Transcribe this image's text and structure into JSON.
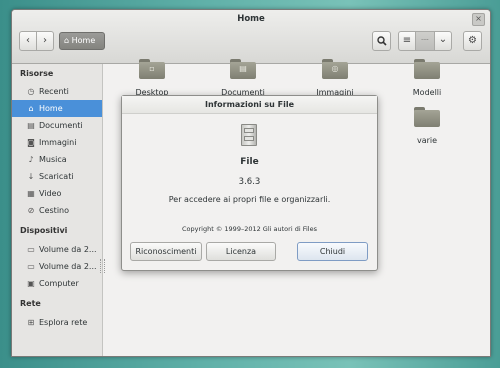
{
  "window": {
    "title": "Home",
    "close_glyph": "×"
  },
  "toolbar": {
    "back_icon": "‹",
    "forward_icon": "›",
    "path_home_label": "Home",
    "search_icon": "search-icon",
    "view_grid_icon": "≡",
    "view_list_icon": "····",
    "view_menu_icon": "⌄",
    "gear_icon": "⚙"
  },
  "sidebar": {
    "sections": [
      {
        "heading": "Risorse"
      },
      {
        "heading": "Dispositivi"
      },
      {
        "heading": "Rete"
      }
    ],
    "items": [
      {
        "label": "Recenti",
        "icon": "clock-icon",
        "glyph": "◷"
      },
      {
        "label": "Home",
        "icon": "home-icon",
        "glyph": "⌂",
        "selected": true
      },
      {
        "label": "Documenti",
        "icon": "document-icon",
        "glyph": "▤"
      },
      {
        "label": "Immagini",
        "icon": "camera-icon",
        "glyph": "◙"
      },
      {
        "label": "Musica",
        "icon": "music-icon",
        "glyph": "♪"
      },
      {
        "label": "Scaricati",
        "icon": "download-icon",
        "glyph": "↓"
      },
      {
        "label": "Video",
        "icon": "film-icon",
        "glyph": "▦"
      },
      {
        "label": "Cestino",
        "icon": "trash-icon",
        "glyph": "⊘"
      },
      {
        "label": "Volume da 2...",
        "icon": "drive-icon",
        "glyph": "▭"
      },
      {
        "label": "Volume da 2...",
        "icon": "drive-icon",
        "glyph": "▭"
      },
      {
        "label": "Computer",
        "icon": "computer-icon",
        "glyph": "▣"
      },
      {
        "label": "Esplora rete",
        "icon": "network-icon",
        "glyph": "⊞"
      }
    ]
  },
  "folders": [
    {
      "label": "Desktop",
      "glyph": "▫"
    },
    {
      "label": "Documenti",
      "glyph": "▤"
    },
    {
      "label": "Immagini",
      "glyph": "◎"
    },
    {
      "label": "Modelli",
      "glyph": ""
    },
    {
      "label": "varie",
      "glyph": ""
    }
  ],
  "dialog": {
    "title": "Informazioni su File",
    "app_name": "File",
    "version": "3.6.3",
    "description": "Per accedere ai propri file e organizzarli.",
    "copyright": "Copyright © 1999–2012 Gli autori di Files",
    "buttons": {
      "credits": "Riconoscimenti",
      "license": "Licenza",
      "close": "Chiudi"
    }
  },
  "colors": {
    "selection": "#4a90d9",
    "folder": "#8f8f82",
    "desktop": "#5fb0a8"
  }
}
